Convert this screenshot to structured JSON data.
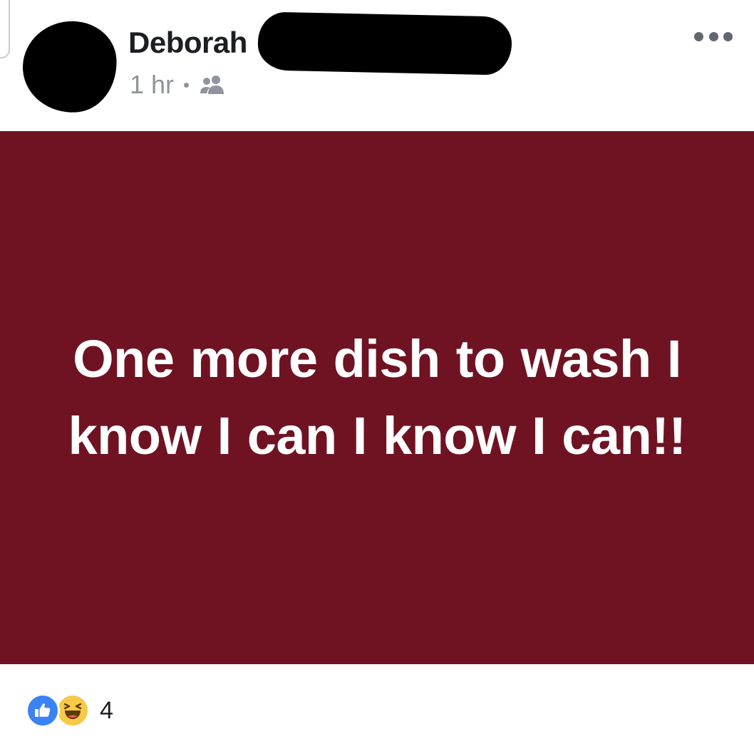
{
  "post": {
    "author_name": "Deborah",
    "timestamp": "1 hr",
    "audience_icon": "friends-icon",
    "more_icon": "more-horizontal-icon",
    "status_text": "One more dish to wash I know I can I know I can!!",
    "background_color": "#6f1323",
    "text_color": "#ffffff"
  },
  "reactions": {
    "types": [
      "like-icon",
      "haha-icon"
    ],
    "count": "4",
    "like_color": "#3b82f6",
    "haha_color": "#f7c948"
  }
}
